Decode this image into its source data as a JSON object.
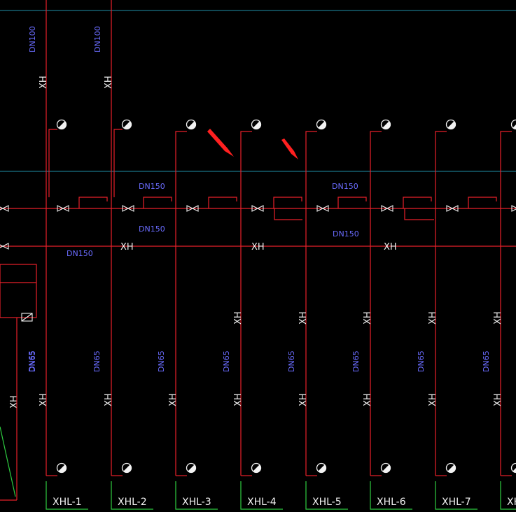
{
  "drawing": {
    "background": "#000000",
    "pipe_color": "#e8202a",
    "grid_color": "#1f8fa8",
    "label_color": "#6a6cff",
    "tag_color": "#f2f2f2",
    "leader_color": "#2ecc40",
    "arrow_color": "#ff2020"
  },
  "labels": {
    "riser_top_1": "DN100",
    "riser_top_2": "DN100",
    "main_upper_1": "DN150",
    "main_upper_2": "DN150",
    "main_lower_1": "DN150",
    "main_lower_2": "DN150",
    "main_lower_3": "DN150",
    "xh_main_1": "XH",
    "xh_main_2": "XH",
    "xh_main_3": "XH",
    "xh_riser": "XH",
    "riser_size": "DN65"
  },
  "risers": [
    {
      "tag": "XHL-1"
    },
    {
      "tag": "XHL-2"
    },
    {
      "tag": "XHL-3"
    },
    {
      "tag": "XHL-4"
    },
    {
      "tag": "XHL-5"
    },
    {
      "tag": "XHL-6"
    },
    {
      "tag": "XHL-7"
    },
    {
      "tag": "XH"
    }
  ]
}
